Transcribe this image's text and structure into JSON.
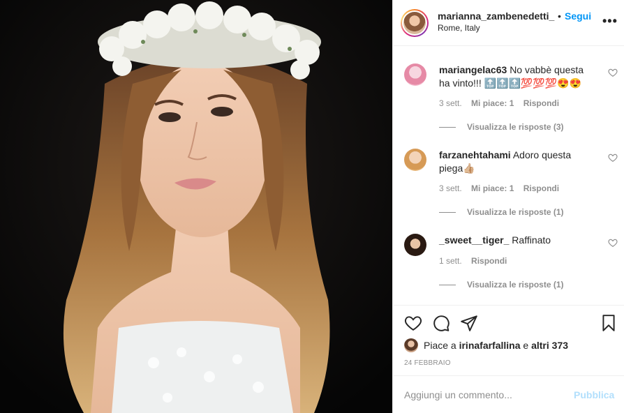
{
  "post": {
    "username": "marianna_zambenedetti_",
    "separator": "•",
    "follow_label": "Segui",
    "location": "Rome, Italy",
    "more_icon": "more-horizontal-icon"
  },
  "comments": [
    {
      "user": "mariangelac63",
      "text": "No vabbè questa ha vinto!!! 🔝🔝🔝💯💯💯😍😍",
      "time": "3 sett.",
      "likes": "Mi piace: 1",
      "reply": "Rispondi",
      "replies": "Visualizza le risposte (3)",
      "avatar_color": "#f4b6c9"
    },
    {
      "user": "farzanehtahami",
      "text": "Adoro questa piega👍🏼",
      "time": "3 sett.",
      "likes": "Mi piace: 1",
      "reply": "Rispondi",
      "replies": "Visualizza le risposte (1)",
      "avatar_color": "#e8b77a"
    },
    {
      "user": "_sweet__tiger_",
      "text": "Raffinato",
      "time": "1 sett.",
      "reply": "Rispondi",
      "replies": "Visualizza le risposte (1)",
      "avatar_color": "#1a1a1a"
    }
  ],
  "likes_line": {
    "prefix": "Piace a",
    "user": "irinafarfallina",
    "middle": "e",
    "others": "altri 373"
  },
  "date": "24 FEBBRAIO",
  "comment_input": {
    "placeholder": "Aggiungi un commento...",
    "publish_label": "Pubblica"
  },
  "colors": {
    "link_blue": "#0095f6",
    "publish_disabled": "#b2dffc",
    "muted": "#8e8e8e",
    "text": "#262626"
  }
}
